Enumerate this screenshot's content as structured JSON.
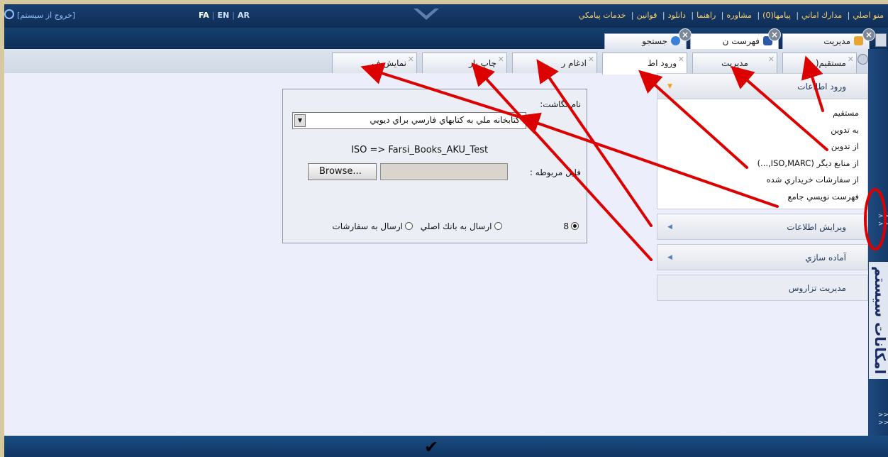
{
  "topbar": {
    "logout": "[خروج از سیستم]",
    "languages": [
      "FA",
      "EN",
      "AR"
    ],
    "menu": [
      "منو اصلي",
      "مدارك اماني",
      "پيامها(0)",
      "مشاوره",
      "راهنما",
      "دانلود",
      "قوانين",
      "خدمات پيامكي"
    ]
  },
  "main_tabs": [
    {
      "label": "مديريت"
    },
    {
      "label": "فهرست ن"
    },
    {
      "label": "جستجو"
    }
  ],
  "sub_tabs": [
    {
      "label": "مستقيم("
    },
    {
      "label": "مديريت"
    },
    {
      "label": "ورود اط"
    },
    {
      "label": "ادغام ر"
    },
    {
      "label": "چاپ بار"
    },
    {
      "label": "نمايش ف"
    }
  ],
  "accordion": {
    "open_header": "ورود اطلاعات",
    "items": [
      "مستقيم",
      "به تدوين",
      "از تدوين",
      "از منابع ديگر (ISO,MARC,...)",
      "از سفارشات خريداري شده",
      "فهرست نويسي جامع"
    ],
    "edit_header": "ويرايش اطلاعات",
    "prep_header": "آماده سازي",
    "thesaurus_header": "مديريت تزاروس"
  },
  "form": {
    "format_label": "نام نگاشت:",
    "format_value": "كتابخانه ملي به كتابهاي فارسي براي ديويي",
    "iso_mapping": "ISO => Farsi_Books_AKU_Test",
    "file_label": "فايل مربوطه :",
    "browse_label": "Browse...",
    "radio_options": [
      "8",
      "ارسال به بانك اصلي",
      "ارسال به سفارشات"
    ]
  },
  "sidebar": {
    "title": "امكانات سيستم",
    "collapse": ">>"
  },
  "bottombar": {
    "confirm_icon": "check-icon"
  },
  "colors": {
    "navy": "#0f2d57",
    "annotation_red": "#dd0000",
    "menu_yellow": "#ffd36b"
  }
}
